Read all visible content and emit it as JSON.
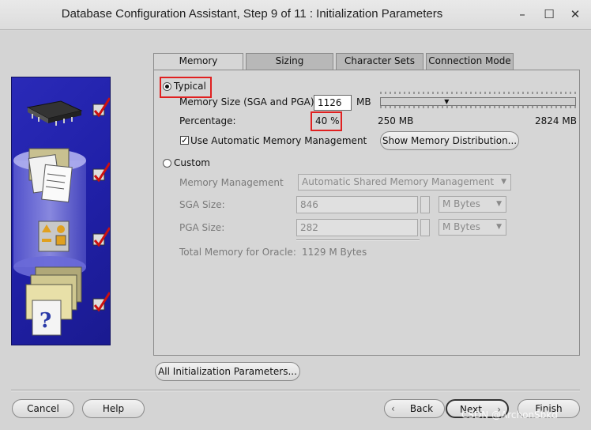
{
  "window": {
    "title": "Database Configuration Assistant, Step 9 of 11 : Initialization Parameters"
  },
  "tabs": [
    "Memory",
    "Sizing",
    "Character Sets",
    "Connection Mode"
  ],
  "typical": {
    "label": "Typical",
    "memory_size_label": "Memory Size (SGA and PGA):",
    "memory_size_value": "1126",
    "memory_unit": "MB",
    "percentage_label": "Percentage:",
    "percentage_value": "40 %",
    "range_min": "250 MB",
    "range_max": "2824 MB",
    "slider_fraction": 0.34,
    "amm_label": "Use Automatic Memory Management",
    "amm_checked": true,
    "show_dist_button": "Show Memory Distribution..."
  },
  "custom": {
    "label": "Custom",
    "mm_label": "Memory Management",
    "mm_value": "Automatic Shared Memory Management",
    "sga_label": "SGA Size:",
    "sga_value": "846",
    "sga_unit": "M Bytes",
    "pga_label": "PGA Size:",
    "pga_value": "282",
    "pga_unit": "M Bytes",
    "total_label": "Total Memory for Oracle:",
    "total_value": "1129 M Bytes"
  },
  "all_params_button": "All Initialization Parameters...",
  "footer": {
    "cancel": "Cancel",
    "help": "Help",
    "back": "Back",
    "next": "Next",
    "finish": "Finish"
  },
  "watermark": "CSDN @ArchonSbkd",
  "colors": {
    "highlight_box": "#e02020",
    "side_panel": "#2424b0",
    "checkmark": "#cc1010"
  }
}
